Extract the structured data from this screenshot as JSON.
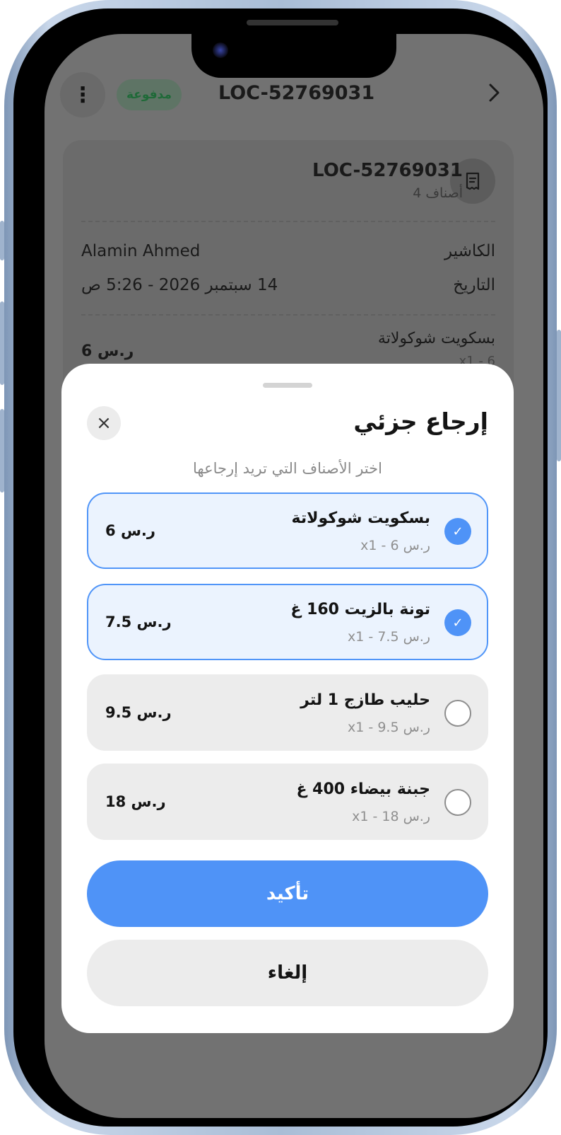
{
  "header": {
    "title": "LOC-52769031",
    "status_badge": "مدفوعة",
    "menu_icon": "more-vertical-icon",
    "back_icon": "chevron-right-icon"
  },
  "summary_card": {
    "order_id": "LOC-52769031",
    "items_count": "4 أصناف",
    "receipt_icon": "receipt-icon",
    "cashier_label": "الكاشير",
    "cashier_value": "Alamin Ahmed",
    "date_label": "التاريخ",
    "date_value": "14 سبتمبر 2026 - 5:26 ص",
    "first_item_name": "بسكويت شوكولاتة",
    "first_item_price": "6 ر.س",
    "first_item_sub": "x1 - 6"
  },
  "sheet": {
    "title": "إرجاع جزئي",
    "subtitle": "اختر الأصناف التي تريد إرجاعها",
    "close_icon": "close-icon",
    "items": [
      {
        "name": "بسكويت شوكولاتة",
        "sub": "x1 - 6 ر.س",
        "price": "6 ر.س",
        "selected": true
      },
      {
        "name": "تونة بالزيت 160 غ",
        "sub": "x1 - 7.5 ر.س",
        "price": "7.5 ر.س",
        "selected": true
      },
      {
        "name": "حليب طازج 1 لتر",
        "sub": "x1 - 9.5 ر.س",
        "price": "9.5 ر.س",
        "selected": false
      },
      {
        "name": "جبنة بيضاء 400 غ",
        "sub": "x1 - 18 ر.س",
        "price": "18 ر.س",
        "selected": false
      }
    ],
    "confirm_label": "تأكيد",
    "cancel_label": "إلغاء"
  },
  "colors": {
    "accent": "#4f93f7",
    "selected_bg": "#ebf3fe",
    "unselected_bg": "#ececec",
    "overlay": "#727272"
  }
}
